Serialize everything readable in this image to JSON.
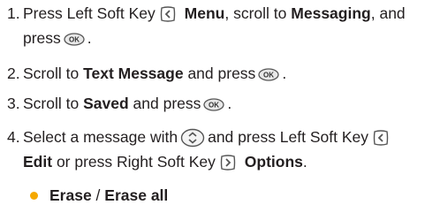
{
  "steps": [
    {
      "number": "1.",
      "line1_pre": "Press Left Soft Key",
      "line1_icon": "left-soft-key-icon",
      "line1_bold1": "Menu",
      "line1_mid": ", scroll to",
      "line1_bold2": "Messaging",
      "line1_post": ", and",
      "line2_pre": "press",
      "line2_icon": "ok-key-icon",
      "line2_post": "."
    },
    {
      "number": "2.",
      "pre": "Scroll to",
      "bold": "Text Message",
      "mid": "and press",
      "icon": "ok-key-icon",
      "post": "."
    },
    {
      "number": "3.",
      "pre": "Scroll to",
      "bold": "Saved",
      "mid": "and press",
      "icon": "ok-key-icon",
      "post": "."
    },
    {
      "number": "4.",
      "line1_pre": "Select a message with",
      "line1_icon1": "nav-key-icon",
      "line1_mid": "and press Left Soft Key",
      "line1_icon2": "left-soft-key-icon",
      "line2_bold1": "Edit",
      "line2_mid": "or press Right Soft Key",
      "line2_icon": "right-soft-key-icon",
      "line2_bold2": "Options",
      "line2_post": "."
    }
  ],
  "bullets": [
    {
      "bold1": "Erase",
      "sep": " / ",
      "bold2": "Erase all"
    }
  ],
  "colors": {
    "text": "#231f20",
    "bullet": "#f5a800",
    "icon": "#555555"
  }
}
